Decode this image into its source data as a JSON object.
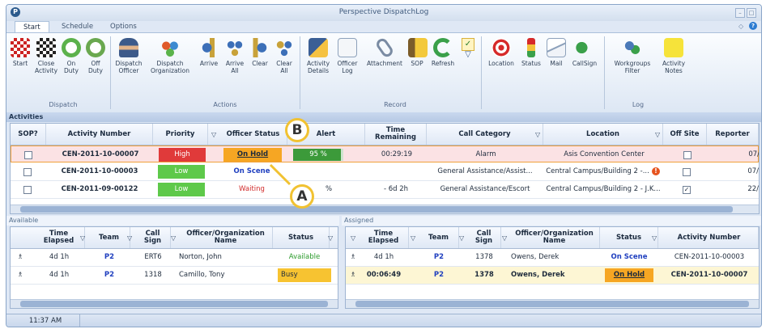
{
  "window": {
    "title": "Perspective DispatchLog",
    "app_icon": "app-logo-icon"
  },
  "tabs": [
    {
      "label": "Start"
    },
    {
      "label": "Schedule"
    },
    {
      "label": "Options"
    }
  ],
  "ribbon": {
    "dispatch": {
      "group": "Dispatch",
      "start": "Start",
      "close_activity": "Close\nActivity",
      "on_duty": "On\nDuty",
      "off_duty": "Off\nDuty"
    },
    "actions": {
      "group": "Actions",
      "dispatch_officer": "Dispatch\nOfficer",
      "dispatch_org": "Dispatch\nOrganization",
      "arrive": "Arrive",
      "arrive_all": "Arrive\nAll",
      "clear": "Clear",
      "clear_all": "Clear\nAll"
    },
    "record": {
      "group": "Record",
      "activity_details": "Activity\nDetails",
      "officer_log": "Officer\nLog",
      "attachment": "Attachment",
      "sop": "SOP",
      "refresh": "Refresh"
    },
    "log": {
      "group": "Log",
      "location": "Location",
      "status": "Status",
      "mail": "Mail",
      "callsign": "CallSign"
    },
    "misc": {
      "workgroups_filter": "Workgroups\nFilter",
      "activity_notes": "Activity\nNotes"
    }
  },
  "activities": {
    "section_label": "Activities",
    "columns": [
      "SOP?",
      "Activity Number",
      "Priority",
      "Officer Status",
      "Alert",
      "Time\nRemaining",
      "Call Category",
      "Location",
      "Off Site",
      "Reporter"
    ],
    "rows": [
      {
        "sop": false,
        "activity": "CEN-2011-10-00007",
        "priority": "High",
        "officer_status": "On Hold",
        "alert": "95 %",
        "time_remaining": "00:29:19",
        "category": "Alarm",
        "location": "Asis Convention Center",
        "off_site": false,
        "reporter": "07/"
      },
      {
        "sop": false,
        "activity": "CEN-2011-10-00003",
        "priority": "Low",
        "officer_status": "On Scene",
        "alert": "",
        "time_remaining": "",
        "category": "General Assistance/Assist...",
        "location": "Central Campus/Building 2 -...",
        "off_site": false,
        "reporter": "07/"
      },
      {
        "sop": false,
        "activity": "CEN-2011-09-00122",
        "priority": "Low",
        "officer_status": "Waiting",
        "alert": "%",
        "time_remaining": "- 6d 2h",
        "category": "General Assistance/Escort",
        "location": "Central Campus/Building 2 - J.K...",
        "off_site": true,
        "reporter": "22/"
      }
    ]
  },
  "available": {
    "section_label": "Available",
    "columns": [
      "Time\nElapsed",
      "Team",
      "Call\nSign",
      "Officer/Organization\nName",
      "Status"
    ],
    "rows": [
      {
        "elapsed": "4d 1h",
        "team": "P2",
        "callsign": "ERT6",
        "name": "Norton, John",
        "status": "Available"
      },
      {
        "elapsed": "4d 1h",
        "team": "P2",
        "callsign": "1318",
        "name": "Camillo, Tony",
        "status": "Busy"
      }
    ]
  },
  "assigned": {
    "section_label": "Assigned",
    "columns": [
      "Time\nElapsed",
      "Team",
      "Call\nSign",
      "Officer/Organization\nName",
      "Status",
      "Activity Number"
    ],
    "rows": [
      {
        "elapsed": "4d 1h",
        "team": "P2",
        "callsign": "1378",
        "name": "Owens, Derek",
        "status": "On Scene",
        "activity": "CEN-2011-10-00003"
      },
      {
        "elapsed": "00:06:49",
        "team": "P2",
        "callsign": "1378",
        "name": "Owens, Derek",
        "status": "On Hold",
        "activity": "CEN-2011-10-00007"
      }
    ]
  },
  "statusbar": {
    "time": "11:37 AM"
  },
  "callouts": {
    "a": "A",
    "b": "B"
  },
  "colors": {
    "high": "#e03a3a",
    "low": "#5ec94a",
    "onhold": "#f6a623",
    "busy": "#f7c331",
    "available_text": "#2a9a2a",
    "onscene_text": "#1f3fbf",
    "waiting_text": "#d12b2b"
  }
}
